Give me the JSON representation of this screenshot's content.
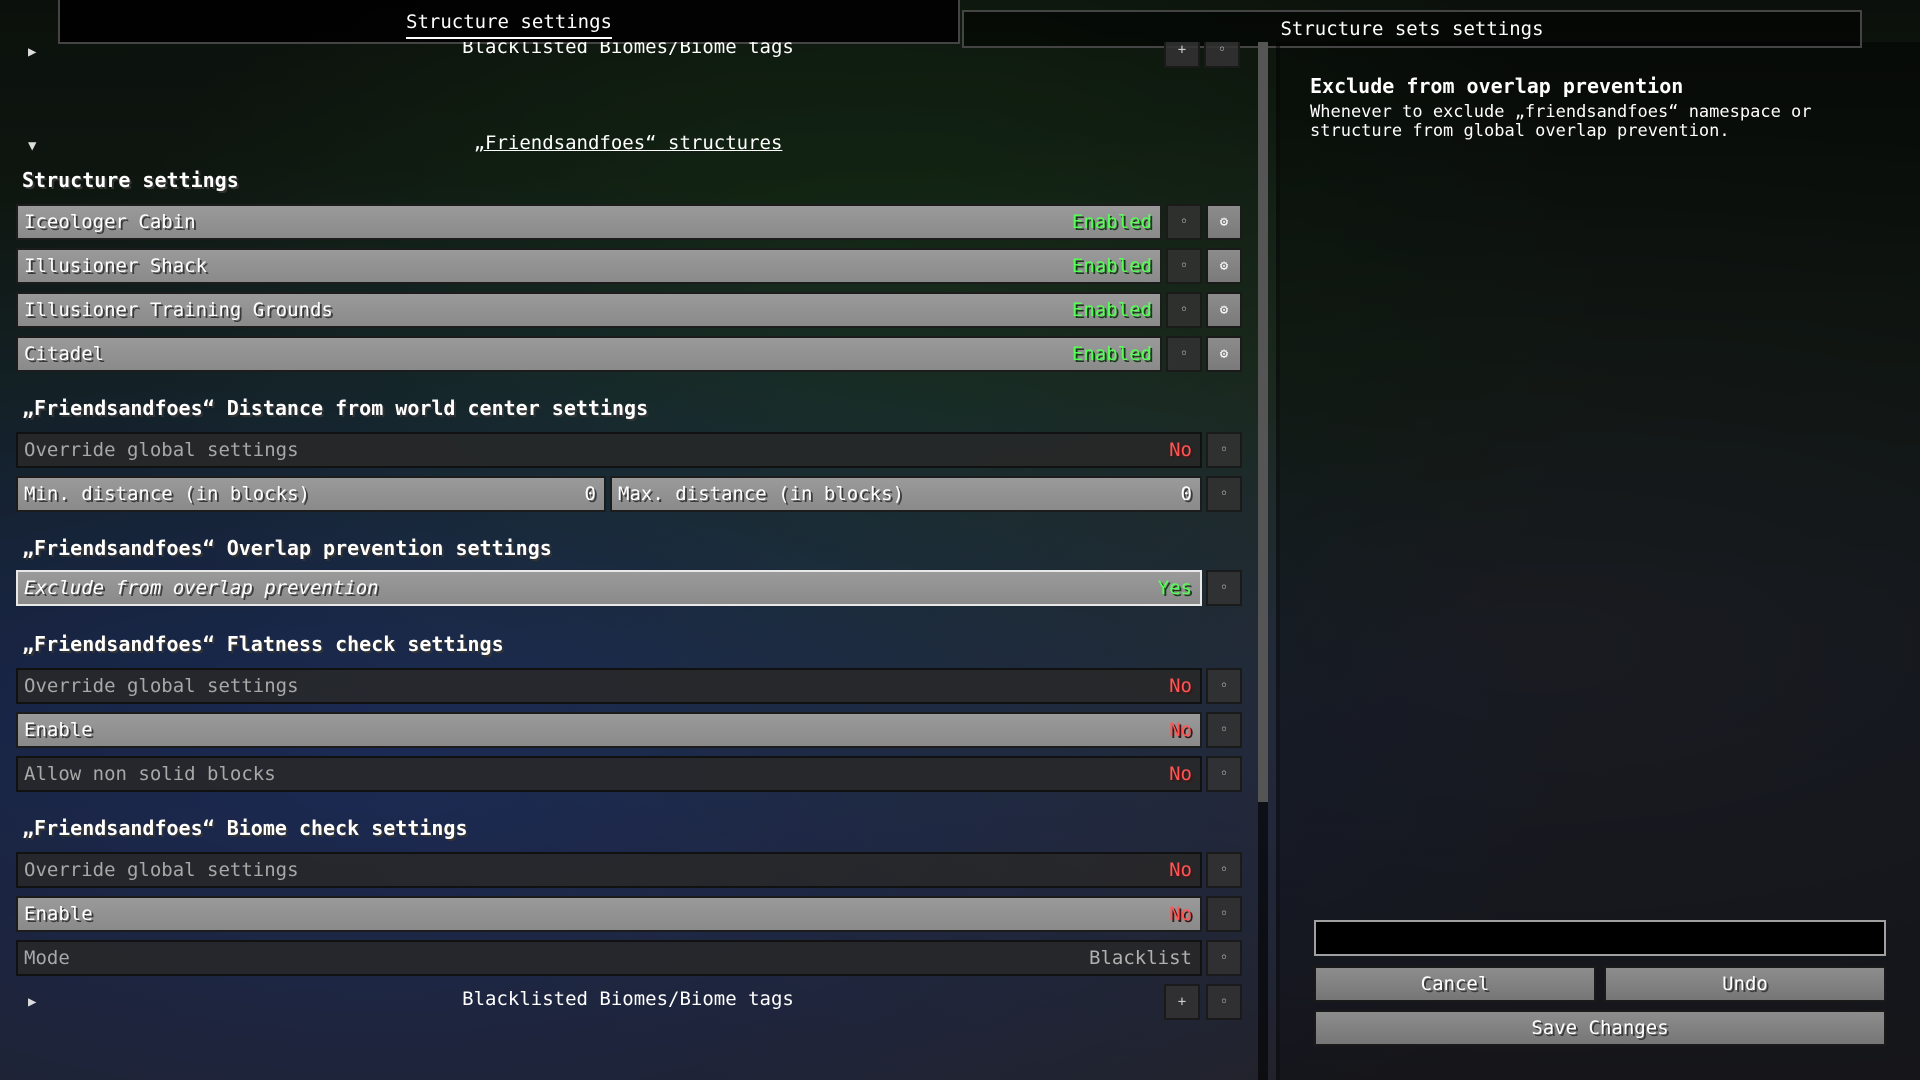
{
  "tabs": {
    "structure": "Structure settings",
    "structure_sets": "Structure sets settings"
  },
  "top": {
    "blacklisted_label": "Blacklisted Biomes/Biome tags",
    "add": "+",
    "reset": "◦"
  },
  "namespace": {
    "link": "„Friendsandfoes“ structures"
  },
  "structure_settings": {
    "heading": "Structure settings",
    "items": [
      {
        "name": "Iceologer Cabin",
        "state": "Enabled"
      },
      {
        "name": "Illusioner Shack",
        "state": "Enabled"
      },
      {
        "name": "Illusioner Training Grounds",
        "state": "Enabled"
      },
      {
        "name": "Citadel",
        "state": "Enabled"
      }
    ]
  },
  "distance": {
    "heading": "„Friendsandfoes“ Distance from world center settings",
    "override_label": "Override global settings",
    "override_value": "No",
    "min_label": "Min. distance (in blocks)",
    "min_value": "0",
    "max_label": "Max. distance (in blocks)",
    "max_value": "0"
  },
  "overlap": {
    "heading": "„Friendsandfoes“ Overlap prevention settings",
    "exclude_label": "Exclude from overlap prevention",
    "exclude_value": "Yes"
  },
  "flatness": {
    "heading": "„Friendsandfoes“ Flatness check settings",
    "override_label": "Override global settings",
    "override_value": "No",
    "enable_label": "Enable",
    "enable_value": "No",
    "nonsolid_label": "Allow non solid blocks",
    "nonsolid_value": "No"
  },
  "biome": {
    "heading": "„Friendsandfoes“ Biome check settings",
    "override_label": "Override global settings",
    "override_value": "No",
    "enable_label": "Enable",
    "enable_value": "No",
    "mode_label": "Mode",
    "mode_value": "Blacklist",
    "blacklisted_label": "Blacklisted Biomes/Biome tags"
  },
  "help": {
    "title": "Exclude from overlap prevention",
    "text": "Whenever to exclude „friendsandfoes“ namespace or structure from global overlap prevention."
  },
  "footer": {
    "input_value": "",
    "cancel": "Cancel",
    "undo": "Undo",
    "save": "Save Changes"
  },
  "icons": {
    "gear": "⚙",
    "reset": "◦",
    "plus": "+",
    "expand": "▶",
    "collapse": "▼"
  },
  "colors": {
    "enabled": "#55ff55",
    "no": "#ff5555",
    "yes": "#55ff55"
  }
}
